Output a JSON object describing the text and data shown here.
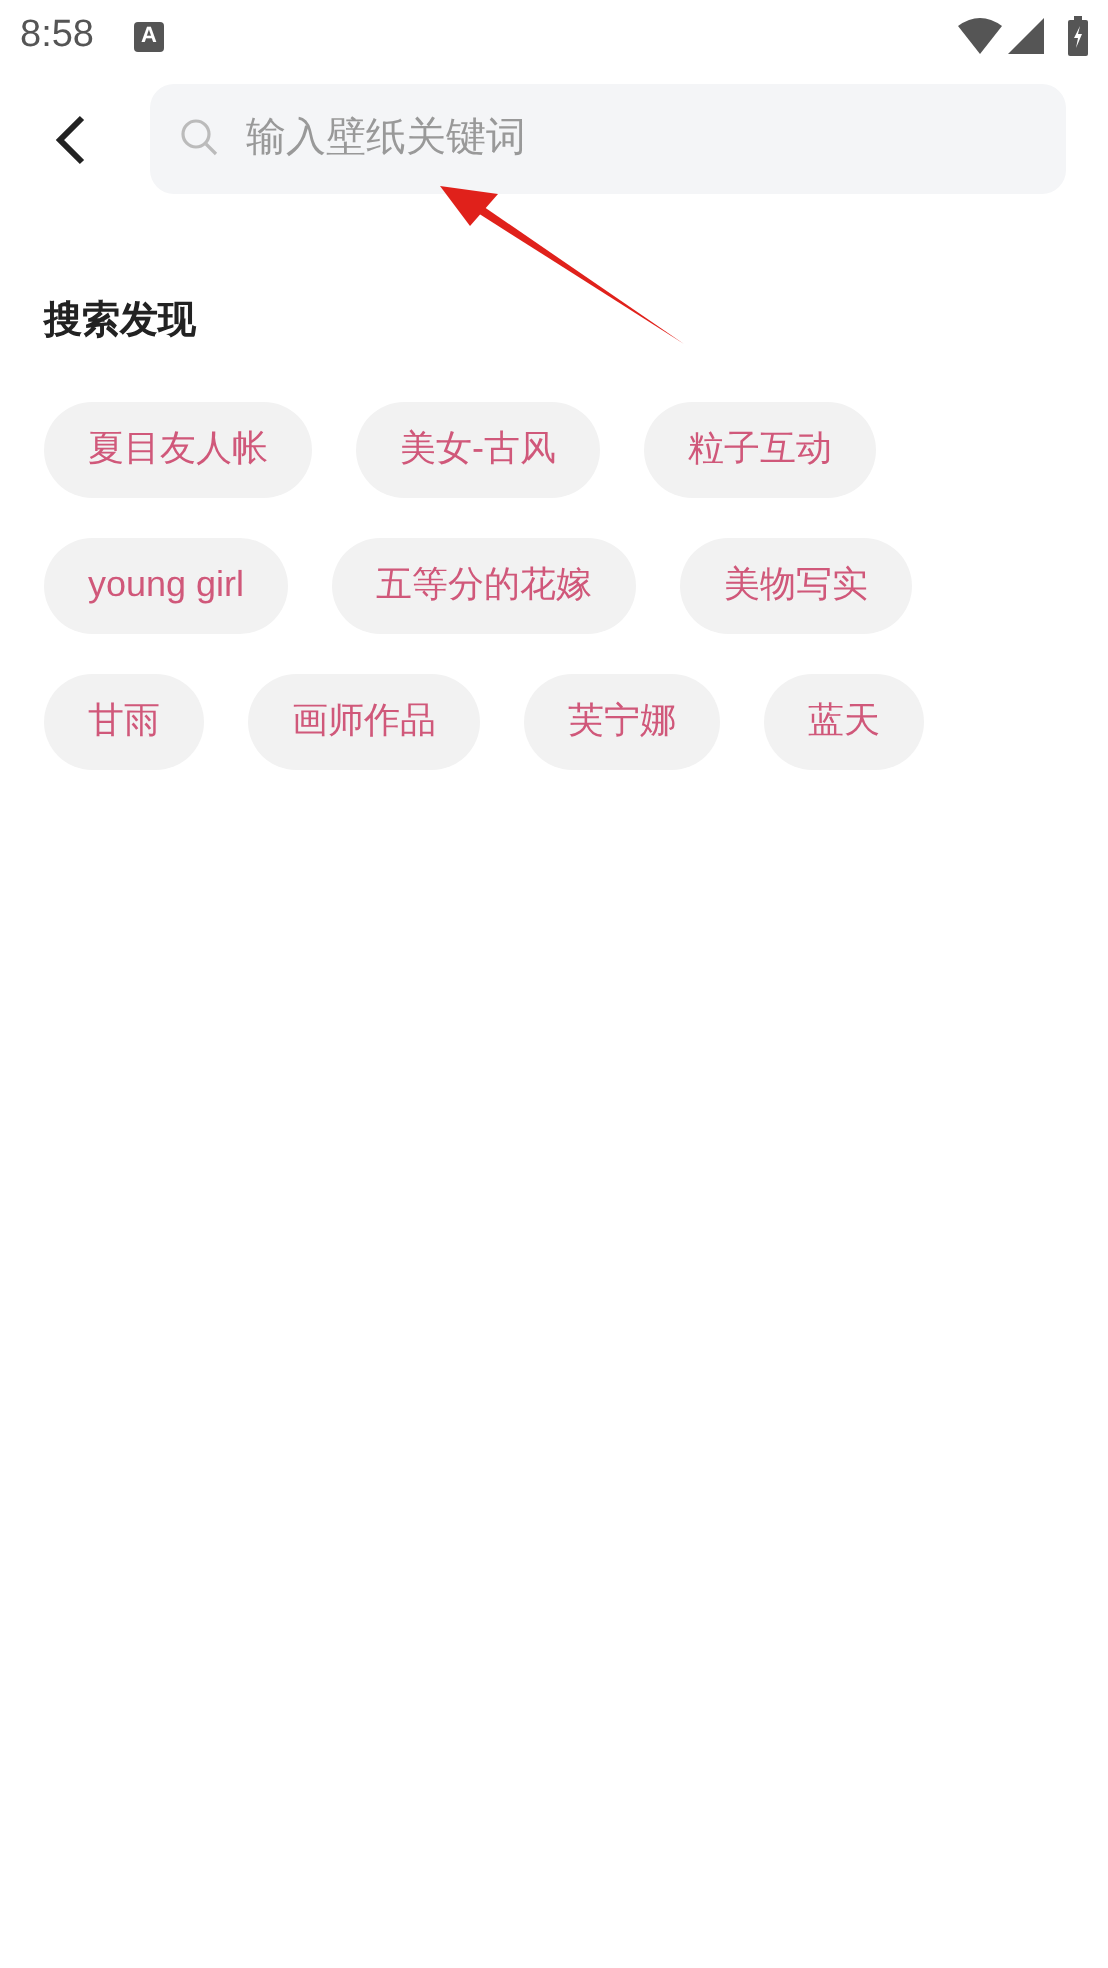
{
  "status_bar": {
    "time": "8:58",
    "notification_icon": "A"
  },
  "search": {
    "placeholder": "输入壁纸关键词"
  },
  "section": {
    "title": "搜索发现",
    "tags": [
      {
        "label": "夏目友人帐"
      },
      {
        "label": "美女-古风"
      },
      {
        "label": "粒子互动"
      },
      {
        "label": "young girl"
      },
      {
        "label": "五等分的花嫁"
      },
      {
        "label": "美物写实"
      },
      {
        "label": "甘雨"
      },
      {
        "label": "画师作品"
      },
      {
        "label": "芙宁娜"
      },
      {
        "label": "蓝天"
      }
    ]
  }
}
